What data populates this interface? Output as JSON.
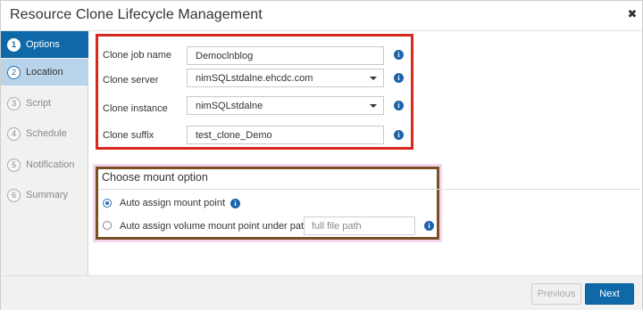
{
  "window": {
    "title": "Resource Clone Lifecycle Management"
  },
  "sidebar": {
    "steps": [
      {
        "number": "1",
        "label": "Options",
        "state": "active"
      },
      {
        "number": "2",
        "label": "Location",
        "state": "current"
      },
      {
        "number": "3",
        "label": "Script",
        "state": "inactive"
      },
      {
        "number": "4",
        "label": "Schedule",
        "state": "inactive"
      },
      {
        "number": "5",
        "label": "Notification",
        "state": "inactive"
      },
      {
        "number": "6",
        "label": "Summary",
        "state": "inactive"
      }
    ]
  },
  "form": {
    "clone_job_name": {
      "label": "Clone job name",
      "value": "Democlnblog"
    },
    "clone_server": {
      "label": "Clone server",
      "value": "nimSQLstdalne.ehcdc.com"
    },
    "clone_instance": {
      "label": "Clone instance",
      "value": "nimSQLstdalne"
    },
    "clone_suffix": {
      "label": "Clone suffix",
      "value": "test_clone_Demo"
    }
  },
  "mount": {
    "section_title": "Choose mount option",
    "auto_assign": {
      "label": "Auto assign mount point",
      "checked": true
    },
    "auto_volume": {
      "label": "Auto assign volume mount point under path",
      "checked": false
    },
    "path_placeholder": "full file path"
  },
  "footer": {
    "previous_label": "Previous",
    "next_label": "Next"
  },
  "icons": {
    "info": "info-icon",
    "close": "close-icon",
    "dropdown": "chevron-down-icon"
  },
  "colors": {
    "accent": "#0f69a8",
    "highlight_red": "#d9271c",
    "highlight_brown": "#7b4f23"
  }
}
